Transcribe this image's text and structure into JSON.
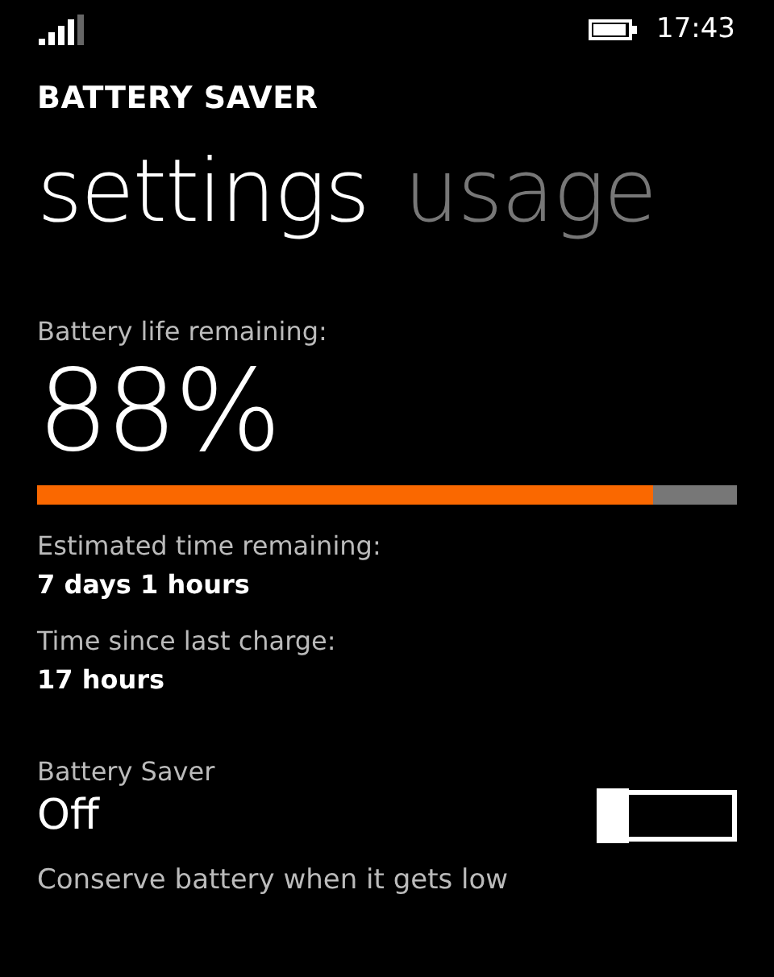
{
  "status_bar": {
    "time": "17:43"
  },
  "app_title": "BATTERY SAVER",
  "pivot": [
    {
      "label": "settings",
      "selected": true
    },
    {
      "label": "usage",
      "selected": false
    }
  ],
  "battery": {
    "label": "Battery life remaining:",
    "percent": "88%",
    "level": 0.88
  },
  "info": [
    {
      "label": "Estimated time remaining:",
      "value": "7 days 1 hours"
    },
    {
      "label": "Time since last charge:",
      "value": "17 hours"
    }
  ],
  "saver": {
    "label": "Battery Saver",
    "state_text": "Off",
    "on": false,
    "description": "Conserve battery when it gets low"
  }
}
